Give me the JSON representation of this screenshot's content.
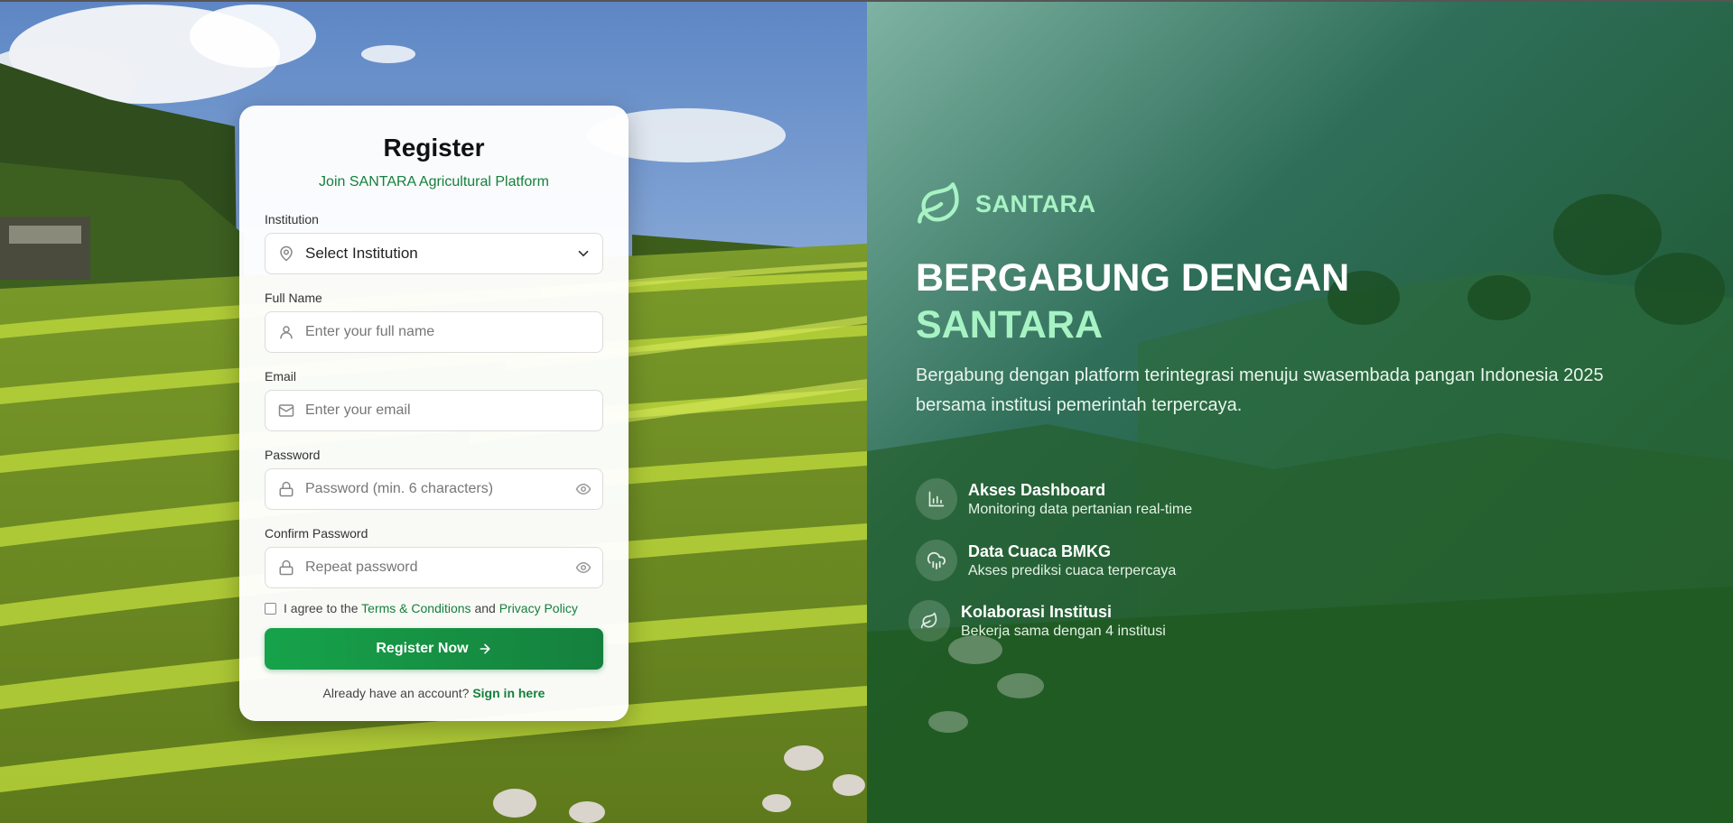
{
  "colors": {
    "brand_green": "#15803d",
    "accent_mint": "#a7f3c4",
    "button_gradient_start": "#16a34a",
    "button_gradient_end": "#15803d"
  },
  "register_card": {
    "title": "Register",
    "subtitle": "Join SANTARA Agricultural Platform",
    "fields": {
      "institution": {
        "label": "Institution",
        "value": "Select Institution",
        "icon": "map-pin-icon"
      },
      "full_name": {
        "label": "Full Name",
        "placeholder": "Enter your full name",
        "icon": "user-icon"
      },
      "email": {
        "label": "Email",
        "placeholder": "Enter your email",
        "icon": "mail-icon"
      },
      "password": {
        "label": "Password",
        "placeholder": "Password (min. 6 characters)",
        "icon": "lock-icon"
      },
      "confirm_password": {
        "label": "Confirm Password",
        "placeholder": "Repeat password",
        "icon": "lock-icon"
      }
    },
    "agreement": {
      "prefix": "I agree to the",
      "terms_link": "Terms & Conditions",
      "conjunction": "and",
      "privacy_link": "Privacy Policy",
      "checked": false
    },
    "submit_label": "Register Now",
    "signin_prompt": "Already have an account?",
    "signin_link": "Sign in here"
  },
  "hero": {
    "brand": "SANTARA",
    "headline_line1": "BERGABUNG DENGAN",
    "headline_line2": "SANTARA",
    "description": "Bergabung dengan platform terintegrasi menuju swasembada pangan Indonesia 2025 bersama institusi pemerintah terpercaya.",
    "features": [
      {
        "title": "Akses Dashboard",
        "desc": "Monitoring data pertanian real-time",
        "icon": "bar-chart-icon"
      },
      {
        "title": "Data Cuaca BMKG",
        "desc": "Akses prediksi cuaca terpercaya",
        "icon": "cloud-rain-icon"
      },
      {
        "title": "Kolaborasi Institusi",
        "desc": "Bekerja sama dengan 4 institusi",
        "icon": "leaf-icon"
      }
    ]
  }
}
